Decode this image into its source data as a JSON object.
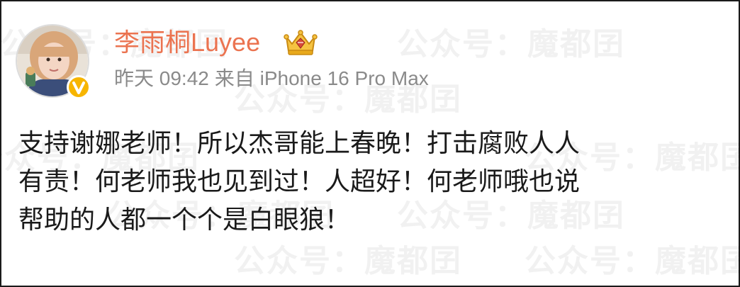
{
  "post": {
    "author": {
      "name": "李雨桐Luyee",
      "verified": true,
      "badge_icon": "vip-crown-icon"
    },
    "meta": {
      "time": "昨天 09:42",
      "source": "来自 iPhone 16 Pro Max"
    },
    "content_lines": [
      "支持谢娜老师！所以杰哥能上春晚！打击腐败人人",
      "有责！何老师我也见到过！人超好！何老师哦也说",
      "帮助的人都一个个是白眼狼！"
    ]
  },
  "watermark": {
    "text": "公众号：魔都囝"
  },
  "colors": {
    "username": "#eb7350",
    "meta": "#8a8a8a",
    "content": "#1a1a1a",
    "verified": "#f7b500"
  }
}
